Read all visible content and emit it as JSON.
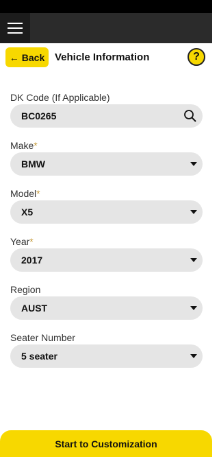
{
  "header": {
    "back_label": "Back",
    "title": "Vehicle Information",
    "help_label": "?"
  },
  "dk_code": {
    "label": "DK Code (If Applicable)",
    "value": "BC0265"
  },
  "make": {
    "label": "Make",
    "required": "*",
    "value": "BMW"
  },
  "model": {
    "label": "Model",
    "required": "*",
    "value": "X5"
  },
  "year": {
    "label": "Year",
    "required": "*",
    "value": "2017"
  },
  "region": {
    "label": "Region",
    "value": "AUST"
  },
  "seater": {
    "label": "Seater Number",
    "value": "5 seater"
  },
  "footer": {
    "button_label": "Start to Customization"
  },
  "colors": {
    "accent": "#f7d800",
    "field_bg": "#e5e5e5",
    "topbar": "#2b2b2b"
  }
}
